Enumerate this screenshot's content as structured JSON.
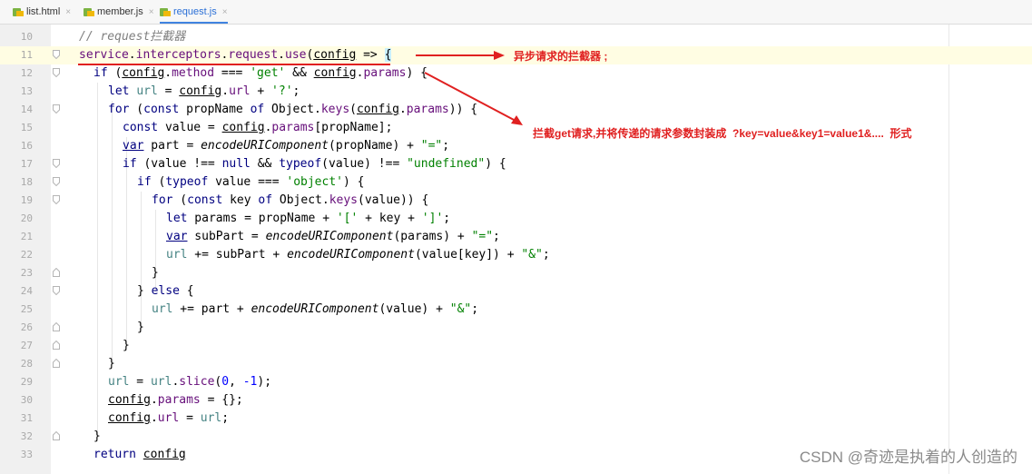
{
  "tabs": [
    {
      "label": "list.html",
      "close": "×",
      "active": false
    },
    {
      "label": "member.js",
      "close": "×",
      "active": false
    },
    {
      "label": "request.js",
      "close": "×",
      "active": true
    }
  ],
  "lines": [
    {
      "n": "10"
    },
    {
      "n": "11"
    },
    {
      "n": "12"
    },
    {
      "n": "13"
    },
    {
      "n": "14"
    },
    {
      "n": "15"
    },
    {
      "n": "16"
    },
    {
      "n": "17"
    },
    {
      "n": "18"
    },
    {
      "n": "19"
    },
    {
      "n": "20"
    },
    {
      "n": "21"
    },
    {
      "n": "22"
    },
    {
      "n": "23"
    },
    {
      "n": "24"
    },
    {
      "n": "25"
    },
    {
      "n": "26"
    },
    {
      "n": "27"
    },
    {
      "n": "28"
    },
    {
      "n": "29"
    },
    {
      "n": "30"
    },
    {
      "n": "31"
    },
    {
      "n": "32"
    },
    {
      "n": "33"
    }
  ],
  "code": {
    "l10": "// request拦截器",
    "service": "service",
    "interceptors": "interceptors",
    "request": "request",
    "use": "use",
    "config": "config",
    "arrow": "=>",
    "ifkw": "if",
    "letkw": "let",
    "forkw": "for",
    "constkw": "const",
    "varkw": "var",
    "ofkw": "of",
    "returnkw": "return",
    "elsekw": "else",
    "typeofkw": "typeof",
    "nullkw": "null",
    "method": "method",
    "params": "params",
    "url": "url",
    "get_str": "'get'",
    "q_str": "'?'",
    "eq_str": "\"=\"",
    "amp_str": "\"&\"",
    "undef_str": "\"undefined\"",
    "obj_str": "'object'",
    "lb_str": "'['",
    "rb_str": "']'",
    "object": "Object",
    "keys": "keys",
    "encode": "encodeURIComponent",
    "slice": "slice",
    "zero": "0",
    "neg1": "-1"
  },
  "annotations": {
    "a1": "异步请求的拦截器 ;",
    "a2": "拦截get请求,并将传递的请求参数封装成  ?key=value&key1=value1&....  形式"
  },
  "watermark": "CSDN @奇迹是执着的人创造的",
  "colors": {
    "annotation": "#e02020",
    "keyword": "#000080",
    "string": "#008000",
    "property": "#660e7a"
  }
}
